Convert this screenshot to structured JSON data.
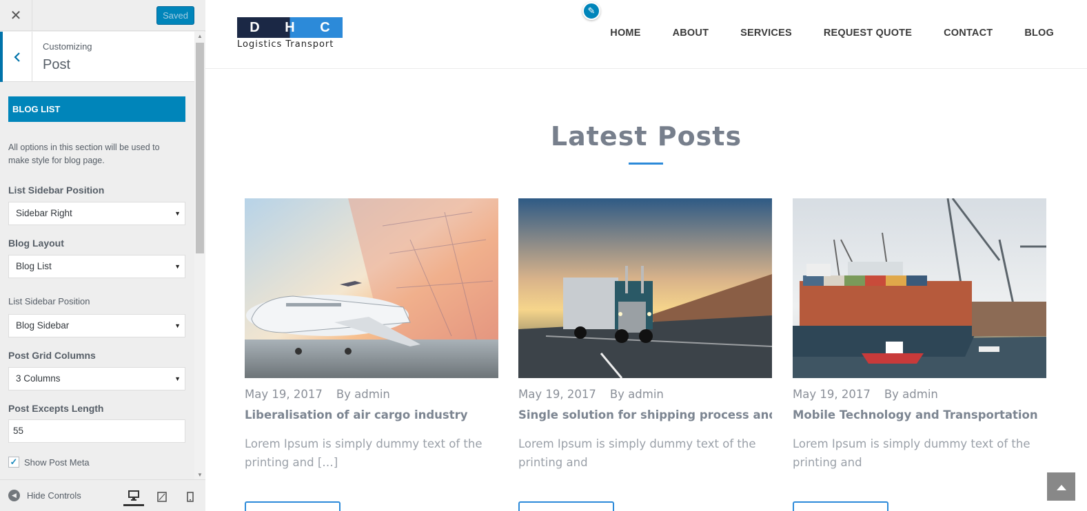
{
  "customizer": {
    "close_icon": "close-icon",
    "saved_label": "Saved",
    "breadcrumb": "Customizing",
    "title": "Post",
    "section_title": "BLOG LIST",
    "description": "All options in this section will be used to make style for blog page.",
    "fields": [
      {
        "label": "List Sidebar Position",
        "value": "Sidebar Right"
      },
      {
        "label": "Blog Layout",
        "value": "Blog List"
      },
      {
        "label": "List Sidebar Position",
        "value": "Blog Sidebar"
      },
      {
        "label": "Post Grid Columns",
        "value": "3 Columns"
      },
      {
        "label": "Post Excepts Length",
        "value": "55"
      }
    ],
    "show_post_meta_label": "Show Post Meta",
    "show_post_meta_checked": true,
    "hide_controls_label": "Hide Controls",
    "devices": [
      "desktop-icon",
      "tablet-icon",
      "mobile-icon"
    ],
    "accent_color": "#0085ba"
  },
  "site": {
    "logo_letters": [
      "D",
      "H",
      "C"
    ],
    "logo_tagline": "Logistics Transport",
    "nav": [
      "HOME",
      "ABOUT",
      "SERVICES",
      "REQUEST QUOTE",
      "CONTACT",
      "BLOG"
    ],
    "section_title": "Latest Posts",
    "posts": [
      {
        "date": "May 19, 2017",
        "author": "By admin",
        "title": "Liberalisation of air cargo industry",
        "excerpt": "Lorem Ipsum is simply dummy text of the printing and […]",
        "image": "airplane-cargo-image"
      },
      {
        "date": "May 19, 2017",
        "author": "By admin",
        "title": "Single solution for shipping process and",
        "excerpt": "Lorem Ipsum is simply dummy text of the printing and",
        "image": "truck-sunset-image"
      },
      {
        "date": "May 19, 2017",
        "author": "By admin",
        "title": "Mobile Technology and Transportation",
        "excerpt": "Lorem Ipsum is simply dummy text of the printing and",
        "image": "container-ship-port-image"
      }
    ],
    "brand_dark": "#1b2845",
    "brand_blue": "#2c8ad9"
  }
}
